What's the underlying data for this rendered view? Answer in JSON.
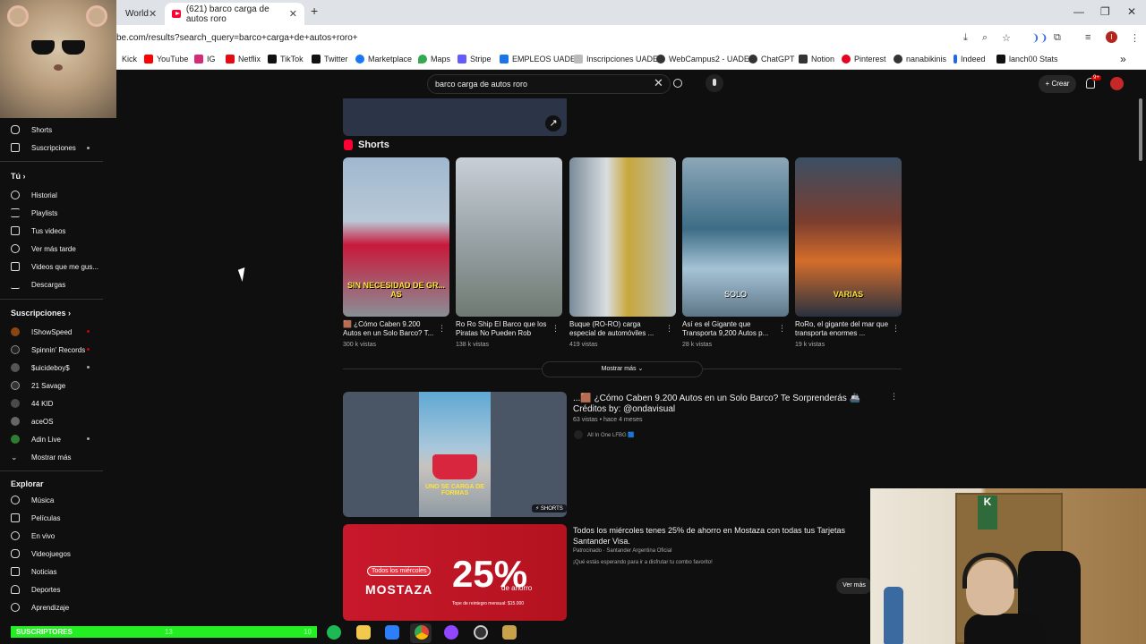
{
  "browser": {
    "tabs": [
      {
        "label": "World",
        "active": false
      },
      {
        "label": "(621) barco carga de autos roro",
        "active": true
      }
    ],
    "new_tab": "+",
    "url": "be.com/results?search_query=barco+carga+de+autos+roro+",
    "window_controls": {
      "minimize": "—",
      "restore": "❐",
      "close": "✕"
    },
    "profile_initial": "I",
    "bookmarks": [
      {
        "label": "Kick",
        "color": "#53fc18"
      },
      {
        "label": "YouTube",
        "color": "#ff0000"
      },
      {
        "label": "IG",
        "color": "#d62976"
      },
      {
        "label": "Netflix",
        "color": "#e50914"
      },
      {
        "label": "TikTok",
        "color": "#111111"
      },
      {
        "label": "Twitter",
        "color": "#111111"
      },
      {
        "label": "Marketplace",
        "color": "#1877f2"
      },
      {
        "label": "Maps",
        "color": "#34a853"
      },
      {
        "label": "Stripe",
        "color": "#635bff"
      },
      {
        "label": "EMPLEOS UADE",
        "color": "#1a73e8"
      },
      {
        "label": "Inscripciones UADE",
        "color": "#777777"
      },
      {
        "label": "WebCampus2 - UADE",
        "color": "#333333"
      },
      {
        "label": "ChatGPT",
        "color": "#333333"
      },
      {
        "label": "Notion",
        "color": "#333333"
      },
      {
        "label": "Pinterest",
        "color": "#e60023"
      },
      {
        "label": "nanabikinis",
        "color": "#333333"
      },
      {
        "label": "Indeed",
        "color": "#2164f3"
      },
      {
        "label": "lanch00 Stats",
        "color": "#111111"
      }
    ],
    "bookmarks_more": "»"
  },
  "youtube": {
    "search_value": "barco carga de autos roro",
    "create_label": "+ Crear",
    "notif_count": "9+",
    "sidebar": {
      "top_items": [
        {
          "label": "Shorts",
          "dot": false
        },
        {
          "label": "Suscripciones",
          "dot": true
        }
      ],
      "you_heading": "Tú  ›",
      "you_items": [
        "Historial",
        "Playlists",
        "Tus videos",
        "Ver más tarde",
        "Videos que me gus...",
        "Descargas"
      ],
      "subs_heading": "Suscripciones  ›",
      "channels": [
        {
          "label": "IShowSpeed",
          "color": "#8b4513",
          "dot": true
        },
        {
          "label": "Spinnin' Records",
          "color": "#222222",
          "dot": true
        },
        {
          "label": "$uicideboy$",
          "color": "#555555",
          "dot": true
        },
        {
          "label": "21 Savage",
          "color": "#333333",
          "dot": false
        },
        {
          "label": "44 KID",
          "color": "#4a4a4a",
          "dot": false
        },
        {
          "label": "aceOS",
          "color": "#666666",
          "dot": false
        },
        {
          "label": "Adin Live",
          "color": "#2e7d32",
          "dot": true
        }
      ],
      "show_more": "Mostrar más",
      "explore_heading": "Explorar",
      "explore_items": [
        "Música",
        "Películas",
        "En vivo",
        "Videojuegos",
        "Noticias",
        "Deportes",
        "Aprendizaje"
      ]
    },
    "shorts_heading": "Shorts",
    "shorts": [
      {
        "title": "🟫 ¿Cómo Caben 9.200 Autos en un Solo Barco? T...",
        "views": "300 k vistas",
        "overlay": "SIN NECESIDAD DE GR... AS",
        "bg": "linear-gradient(#9fb8cf 0%, #b9c9d6 40%, #c8193a 55%, #8a8f97 100%)"
      },
      {
        "title": "Ro Ro Ship El Barco que los Piratas No Pueden Rob",
        "views": "138 k vistas",
        "overlay": "",
        "bg": "linear-gradient(#c8cfd6 0%, #9aa4a8 50%, #6f7a72 100%)"
      },
      {
        "title": "Buque (RO-RO) carga especial de automóviles ...",
        "views": "419 vistas",
        "overlay": "",
        "bg": "linear-gradient(90deg, #7a8c99 0%, #d9dde0 35%, #c8a83a 55%, #b8c0c6 100%)"
      },
      {
        "title": "Así es el Gigante que Transporta 9,200 Autos p...",
        "views": "28 k vistas",
        "overlay": "SOLO",
        "bg": "linear-gradient(#8da7b8 0%, #3d6d86 45%, #a6c3d6 70%, #5d7687 100%)"
      },
      {
        "title": "RoRo, el gigante del mar que transporta enormes ...",
        "views": "19 k vistas",
        "overlay": "VARIAS",
        "bg": "linear-gradient(#3b4f64 0%, #7a3d2f 40%, #d46d2a 65%, #283140 100%)"
      }
    ],
    "show_more_label": "Mostrar más  ⌄",
    "video": {
      "title": "...🟫 ¿Cómo Caben 9.200 Autos en un Solo Barco? Te Sorprenderás 🚢 Créditos by: @ondavisual",
      "meta": "63 vistas • hace 4 meses",
      "channel": "All In One LFBG 🟦",
      "overlay": "UNO SE CARGA DE FORMAS",
      "badge": "⚡ SHORTS"
    },
    "ad": {
      "pill": "Todos los miércoles",
      "brand": "MOSTAZA",
      "percent": "25%",
      "percent_sub": "de ahorro",
      "fine": "Tope de reintegro mensual: $15.000",
      "title": "Todos los miércoles tenes 25% de ahorro en Mostaza con todas tus Tarjetas Santander Visa.",
      "sponsor": "Patrocinado · Santander Argentina Oficial",
      "desc": "¡Qué estás esperando para ir a disfrutar tu combo favorito!",
      "cta": "Ver más"
    }
  },
  "overlay": {
    "subs_label": "SUSCRIPTORES",
    "subs_left": "13",
    "subs_right": "10"
  }
}
